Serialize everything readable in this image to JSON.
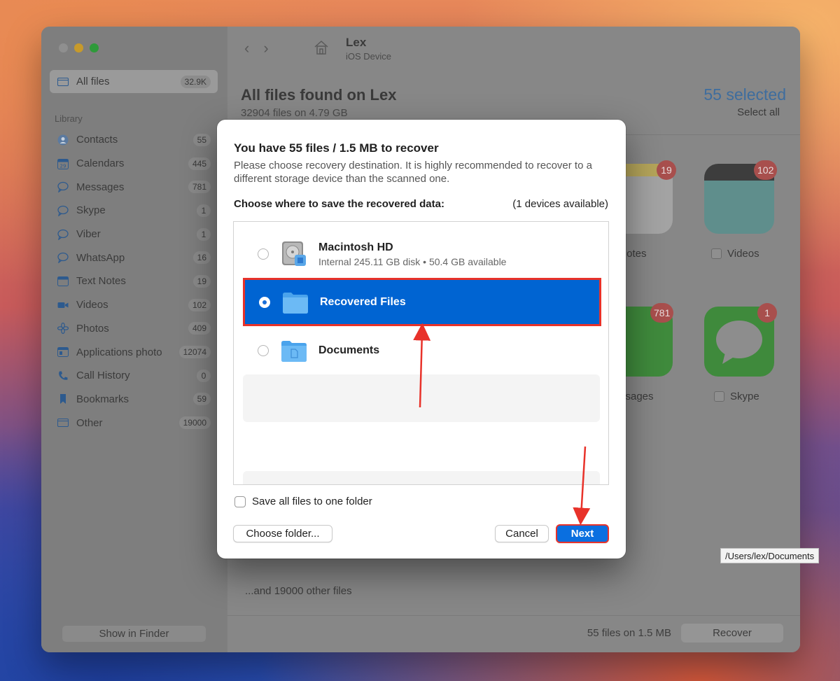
{
  "window": {
    "device_name": "Lex",
    "device_type": "iOS Device",
    "title": "All files found on Lex",
    "subtitle": "32904 files on 4.79 GB",
    "selected_label": "55 selected",
    "select_all": "Select all"
  },
  "sidebar": {
    "all_files": {
      "label": "All files",
      "count": "32.9K",
      "icon": "folder-icon"
    },
    "section": "Library",
    "items": [
      {
        "label": "Contacts",
        "count": "55",
        "icon": "contacts-icon"
      },
      {
        "label": "Calendars",
        "count": "445",
        "icon": "calendar-icon"
      },
      {
        "label": "Messages",
        "count": "781",
        "icon": "message-icon"
      },
      {
        "label": "Skype",
        "count": "1",
        "icon": "message-icon"
      },
      {
        "label": "Viber",
        "count": "1",
        "icon": "message-icon"
      },
      {
        "label": "WhatsApp",
        "count": "16",
        "icon": "message-icon"
      },
      {
        "label": "Text Notes",
        "count": "19",
        "icon": "notes-icon"
      },
      {
        "label": "Videos",
        "count": "102",
        "icon": "video-icon"
      },
      {
        "label": "Photos",
        "count": "409",
        "icon": "photos-icon"
      },
      {
        "label": "Applications photo",
        "count": "12074",
        "icon": "app-photo-icon"
      },
      {
        "label": "Call History",
        "count": "0",
        "icon": "phone-icon"
      },
      {
        "label": "Bookmarks",
        "count": "59",
        "icon": "bookmark-icon"
      },
      {
        "label": "Other",
        "count": "19000",
        "icon": "other-icon"
      }
    ],
    "show_in_finder": "Show in Finder"
  },
  "tiles": [
    {
      "name": "text-notes-tile",
      "label": "t Notes",
      "badge": "19"
    },
    {
      "name": "videos-tile",
      "label": "Videos",
      "badge": "102"
    },
    {
      "name": "messages-tile",
      "label": "ssages",
      "badge": "781"
    },
    {
      "name": "skype-tile",
      "label": "Skype",
      "badge": "1"
    }
  ],
  "footer": {
    "other_files": "...and 19000 other files",
    "summary": "55 files on 1.5 MB",
    "recover": "Recover"
  },
  "dialog": {
    "title": "You have 55 files / 1.5 MB to recover",
    "description": "Please choose recovery destination. It is highly recommended to recover to a different storage device than the scanned one.",
    "choose_label": "Choose where to save the recovered data:",
    "available": "(1 devices available)",
    "destinations": [
      {
        "name": "Macintosh HD",
        "detail": "Internal 245.11 GB disk • 50.4 GB available",
        "selected": false,
        "icon": "hard-drive-icon"
      },
      {
        "name": "Recovered Files",
        "detail": "",
        "selected": true,
        "icon": "folder-icon"
      },
      {
        "name": "Documents",
        "detail": "",
        "selected": false,
        "icon": "documents-folder-icon"
      }
    ],
    "save_one_folder": "Save all files to one folder",
    "choose_folder": "Choose folder...",
    "cancel": "Cancel",
    "next": "Next"
  },
  "tooltip": "/Users/lex/Documents",
  "colors": {
    "accent_blue": "#0064d2",
    "highlight_red": "#e8322a",
    "selected_text": "#3e6d9e"
  }
}
